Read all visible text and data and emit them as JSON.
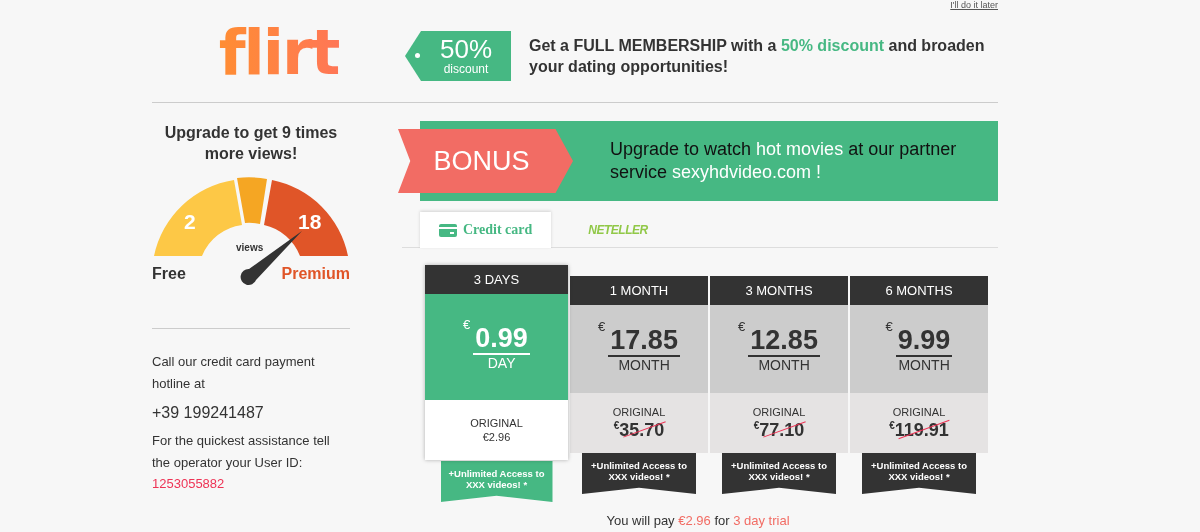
{
  "skip_link": "I'll do it later",
  "logo": {
    "text": "flirt"
  },
  "discount_tag": {
    "value": "50%",
    "label": "discount"
  },
  "promo": [
    {
      "text": "Get a FULL MEMBERSHIP with a ",
      "highlight": false
    },
    {
      "text": "50% discount",
      "highlight": true
    },
    {
      "text": " and broaden your dating opportunities!",
      "highlight": false
    }
  ],
  "sidebar": {
    "title": "Upgrade to get 9 times more views!",
    "gauge": {
      "free_value": "2",
      "premium_value": "18",
      "unit": "views",
      "free_label": "Free",
      "premium_label": "Premium"
    },
    "hotline_text": "Call our credit card payment hotline at",
    "phone": "+39 199241487",
    "assist_text": "For the quickest assistance tell the operator your User ID:",
    "user_id": "1253055882"
  },
  "bonus": {
    "badge": "BONUS",
    "message": [
      {
        "text": "Upgrade to watch ",
        "highlight": false
      },
      {
        "text": "hot movies",
        "highlight": true
      },
      {
        "text": " at our partner service ",
        "highlight": false
      },
      {
        "text": "sexyhdvideo.com !",
        "highlight": true
      }
    ]
  },
  "tabs": [
    {
      "label": "Credit card",
      "kind": "card",
      "selected": true
    },
    {
      "label": "NETELLER",
      "kind": "logo",
      "selected": false
    }
  ],
  "plans": [
    {
      "period": "3 DAYS",
      "currency": "€",
      "price": "0.99",
      "unit": "DAY",
      "original_label": "ORIGINAL",
      "original_price": "€2.96",
      "struck": false,
      "perk": "+Unlimited Access to XXX videos! *",
      "selected": true
    },
    {
      "period": "1 MONTH",
      "currency": "€",
      "price": "17.85",
      "unit": "MONTH",
      "original_label": "ORIGINAL",
      "original_currency": "€",
      "original_price": "35.70",
      "struck": true,
      "perk": "+Unlimited Access to XXX videos! *",
      "selected": false
    },
    {
      "period": "3 MONTHS",
      "currency": "€",
      "price": "12.85",
      "unit": "MONTH",
      "original_label": "ORIGINAL",
      "original_currency": "€",
      "original_price": "77.10",
      "struck": true,
      "perk": "+Unlimited Access to XXX videos! *",
      "selected": false
    },
    {
      "period": "6 MONTHS",
      "currency": "€",
      "price": "9.99",
      "unit": "MONTH",
      "original_label": "ORIGINAL",
      "original_currency": "€",
      "original_price": "119.91",
      "struck": true,
      "perk": "+Unlimited Access to XXX videos! *",
      "selected": false
    }
  ],
  "summary": [
    {
      "text": "You will pay ",
      "highlight": false
    },
    {
      "text": "€2.96",
      "highlight": true
    },
    {
      "text": " for ",
      "highlight": false
    },
    {
      "text": "3 day trial",
      "highlight": true
    }
  ]
}
